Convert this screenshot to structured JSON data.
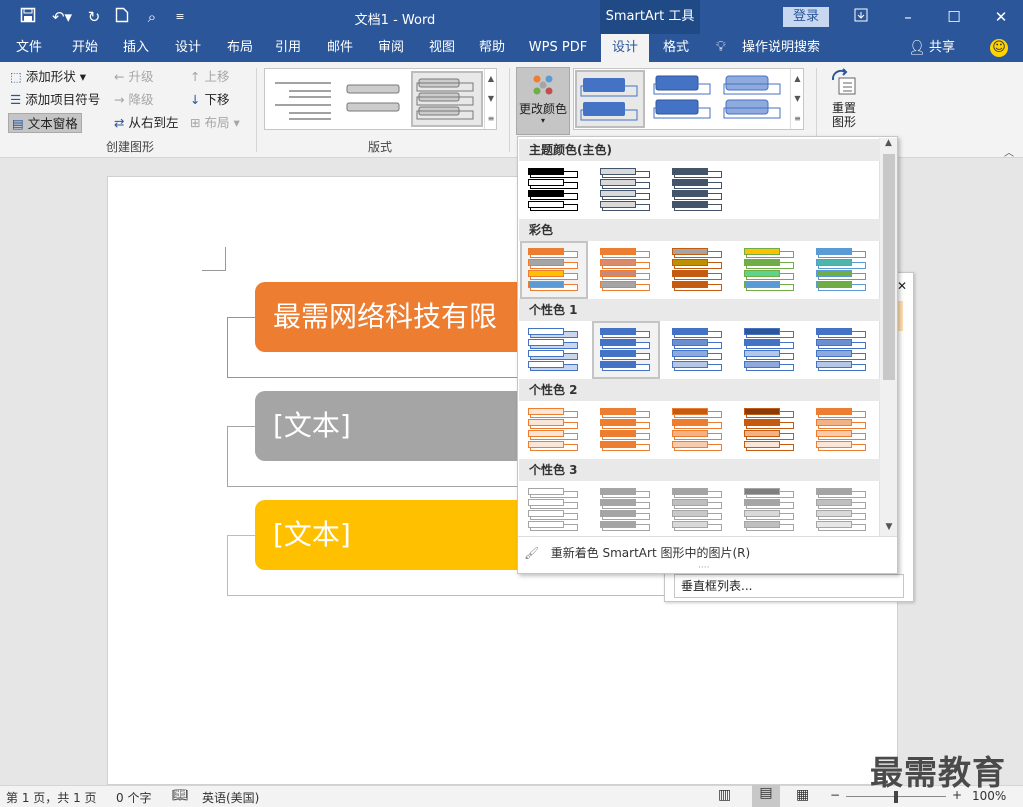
{
  "titlebar": {
    "doc_title": "文档1  -  Word",
    "context_tab": "SmartArt 工具",
    "login": "登录"
  },
  "tabs": [
    "文件",
    "开始",
    "插入",
    "设计",
    "布局",
    "引用",
    "邮件",
    "审阅",
    "视图",
    "帮助",
    "WPS PDF",
    "设计",
    "格式"
  ],
  "tell_me": "操作说明搜索",
  "share": "共享",
  "ribbon": {
    "add_shape": "添加形状",
    "add_bullet": "添加项目符号",
    "text_pane": "文本窗格",
    "promote": "升级",
    "demote": "降级",
    "rtl": "从右到左",
    "move_up": "上移",
    "move_down": "下移",
    "layout": "布局",
    "create_group": "创建图形",
    "layouts_group": "版式",
    "change_colors": "更改颜色",
    "reset_line1": "重置",
    "reset_line2": "图形"
  },
  "dropdown": {
    "sections": [
      "主题颜色(主色)",
      "彩色",
      "个性色 1",
      "个性色 2",
      "个性色 3"
    ],
    "recolor": "重新着色 SmartArt 图形中的图片(R)"
  },
  "document": {
    "item1": "最需网络科技有限",
    "item2": "[文本]",
    "item3": "[文本]",
    "tooltip": "垂直框列表..."
  },
  "status": {
    "page": "第 1 页，共 1 页",
    "words": "0 个字",
    "lang": "英语(美国)",
    "zoom": "100%"
  },
  "watermark": "最需教育",
  "colors": {
    "accent": "#2b579a",
    "orange": "#ed7d31",
    "gray": "#a5a5a5",
    "gold": "#ffc000"
  }
}
